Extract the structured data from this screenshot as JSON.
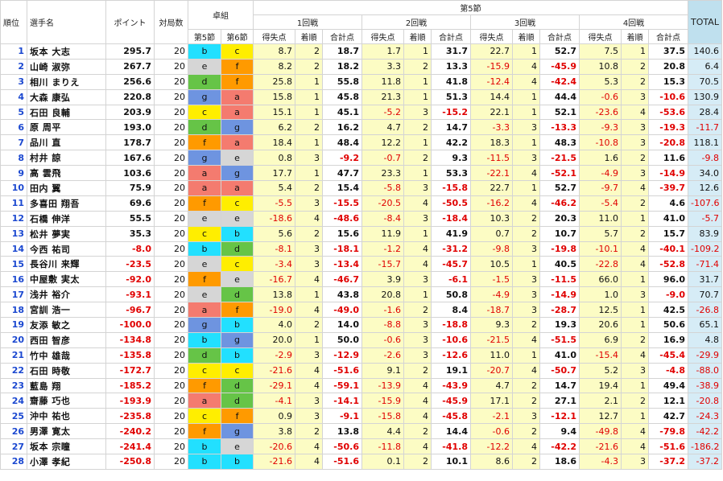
{
  "headers": {
    "rank": "順位",
    "player": "選手名",
    "points": "ポイント",
    "games": "対局数",
    "table_group": "卓組",
    "section5": "第5節",
    "section6": "第6節",
    "stage": "第5節",
    "round1": "1回戦",
    "round2": "2回戦",
    "round3": "3回戦",
    "round4": "4回戦",
    "gain": "得失点",
    "order": "着順",
    "subtotal": "合計点",
    "total": "TOTAL"
  },
  "colors": {
    "a": "#f47b6f",
    "b": "#22e0ff",
    "c": "#ffee00",
    "d": "#66c447",
    "e": "#d6d6d6",
    "f": "#ff9a00",
    "g": "#6e94e0",
    "negative": "#e00000",
    "rank": "#1b48d0"
  },
  "rows": [
    {
      "rank": "1",
      "name": "坂本 大志",
      "points": "295.7",
      "games": "20",
      "t5": "b",
      "t6": "c",
      "r1g": "8.7",
      "r1o": "2",
      "r1s": "18.7",
      "r2g": "1.7",
      "r2o": "1",
      "r2s": "31.7",
      "r3g": "22.7",
      "r3o": "1",
      "r3s": "52.7",
      "r4g": "7.5",
      "r4o": "1",
      "r4s": "37.5",
      "total": "140.6"
    },
    {
      "rank": "2",
      "name": "山崎 淑弥",
      "points": "267.7",
      "games": "20",
      "t5": "e",
      "t6": "f",
      "r1g": "8.2",
      "r1o": "2",
      "r1s": "18.2",
      "r2g": "3.3",
      "r2o": "2",
      "r2s": "13.3",
      "r3g": "-15.9",
      "r3o": "4",
      "r3s": "-45.9",
      "r4g": "10.8",
      "r4o": "2",
      "r4s": "20.8",
      "total": "6.4"
    },
    {
      "rank": "3",
      "name": "相川 まりえ",
      "points": "256.6",
      "games": "20",
      "t5": "d",
      "t6": "f",
      "r1g": "25.8",
      "r1o": "1",
      "r1s": "55.8",
      "r2g": "11.8",
      "r2o": "1",
      "r2s": "41.8",
      "r3g": "-12.4",
      "r3o": "4",
      "r3s": "-42.4",
      "r4g": "5.3",
      "r4o": "2",
      "r4s": "15.3",
      "total": "70.5"
    },
    {
      "rank": "4",
      "name": "大森 康弘",
      "points": "220.8",
      "games": "20",
      "t5": "g",
      "t6": "a",
      "r1g": "15.8",
      "r1o": "1",
      "r1s": "45.8",
      "r2g": "21.3",
      "r2o": "1",
      "r2s": "51.3",
      "r3g": "14.4",
      "r3o": "1",
      "r3s": "44.4",
      "r4g": "-0.6",
      "r4o": "3",
      "r4s": "-10.6",
      "total": "130.9"
    },
    {
      "rank": "5",
      "name": "石田 良輔",
      "points": "203.9",
      "games": "20",
      "t5": "c",
      "t6": "a",
      "r1g": "15.1",
      "r1o": "1",
      "r1s": "45.1",
      "r2g": "-5.2",
      "r2o": "3",
      "r2s": "-15.2",
      "r3g": "22.1",
      "r3o": "1",
      "r3s": "52.1",
      "r4g": "-23.6",
      "r4o": "4",
      "r4s": "-53.6",
      "total": "28.4"
    },
    {
      "rank": "6",
      "name": "原 周平",
      "points": "193.0",
      "games": "20",
      "t5": "d",
      "t6": "g",
      "r1g": "6.2",
      "r1o": "2",
      "r1s": "16.2",
      "r2g": "4.7",
      "r2o": "2",
      "r2s": "14.7",
      "r3g": "-3.3",
      "r3o": "3",
      "r3s": "-13.3",
      "r4g": "-9.3",
      "r4o": "3",
      "r4s": "-19.3",
      "total": "-11.7"
    },
    {
      "rank": "7",
      "name": "品川 直",
      "points": "178.7",
      "games": "20",
      "t5": "f",
      "t6": "a",
      "r1g": "18.4",
      "r1o": "1",
      "r1s": "48.4",
      "r2g": "12.2",
      "r2o": "1",
      "r2s": "42.2",
      "r3g": "18.3",
      "r3o": "1",
      "r3s": "48.3",
      "r4g": "-10.8",
      "r4o": "3",
      "r4s": "-20.8",
      "total": "118.1"
    },
    {
      "rank": "8",
      "name": "村井 諒",
      "points": "167.6",
      "games": "20",
      "t5": "g",
      "t6": "e",
      "r1g": "0.8",
      "r1o": "3",
      "r1s": "-9.2",
      "r2g": "-0.7",
      "r2o": "2",
      "r2s": "9.3",
      "r3g": "-11.5",
      "r3o": "3",
      "r3s": "-21.5",
      "r4g": "1.6",
      "r4o": "2",
      "r4s": "11.6",
      "total": "-9.8"
    },
    {
      "rank": "9",
      "name": "高 雲飛",
      "points": "103.6",
      "games": "20",
      "t5": "a",
      "t6": "g",
      "r1g": "17.7",
      "r1o": "1",
      "r1s": "47.7",
      "r2g": "23.3",
      "r2o": "1",
      "r2s": "53.3",
      "r3g": "-22.1",
      "r3o": "4",
      "r3s": "-52.1",
      "r4g": "-4.9",
      "r4o": "3",
      "r4s": "-14.9",
      "total": "34.0"
    },
    {
      "rank": "10",
      "name": "田内 翼",
      "points": "75.9",
      "games": "20",
      "t5": "a",
      "t6": "a",
      "r1g": "5.4",
      "r1o": "2",
      "r1s": "15.4",
      "r2g": "-5.8",
      "r2o": "3",
      "r2s": "-15.8",
      "r3g": "22.7",
      "r3o": "1",
      "r3s": "52.7",
      "r4g": "-9.7",
      "r4o": "4",
      "r4s": "-39.7",
      "total": "12.6"
    },
    {
      "rank": "11",
      "name": "多喜田 翔吾",
      "points": "69.6",
      "games": "20",
      "t5": "f",
      "t6": "c",
      "r1g": "-5.5",
      "r1o": "3",
      "r1s": "-15.5",
      "r2g": "-20.5",
      "r2o": "4",
      "r2s": "-50.5",
      "r3g": "-16.2",
      "r3o": "4",
      "r3s": "-46.2",
      "r4g": "-5.4",
      "r4o": "2",
      "r4s": "4.6",
      "total": "-107.6"
    },
    {
      "rank": "12",
      "name": "石橋 伸洋",
      "points": "55.5",
      "games": "20",
      "t5": "e",
      "t6": "e",
      "r1g": "-18.6",
      "r1o": "4",
      "r1s": "-48.6",
      "r2g": "-8.4",
      "r2o": "3",
      "r2s": "-18.4",
      "r3g": "10.3",
      "r3o": "2",
      "r3s": "20.3",
      "r4g": "11.0",
      "r4o": "1",
      "r4s": "41.0",
      "total": "-5.7"
    },
    {
      "rank": "13",
      "name": "松井 夢実",
      "points": "35.3",
      "games": "20",
      "t5": "c",
      "t6": "b",
      "r1g": "5.6",
      "r1o": "2",
      "r1s": "15.6",
      "r2g": "11.9",
      "r2o": "1",
      "r2s": "41.9",
      "r3g": "0.7",
      "r3o": "2",
      "r3s": "10.7",
      "r4g": "5.7",
      "r4o": "2",
      "r4s": "15.7",
      "total": "83.9"
    },
    {
      "rank": "14",
      "name": "今西 祐司",
      "points": "-8.0",
      "games": "20",
      "t5": "b",
      "t6": "d",
      "r1g": "-8.1",
      "r1o": "3",
      "r1s": "-18.1",
      "r2g": "-1.2",
      "r2o": "4",
      "r2s": "-31.2",
      "r3g": "-9.8",
      "r3o": "3",
      "r3s": "-19.8",
      "r4g": "-10.1",
      "r4o": "4",
      "r4s": "-40.1",
      "total": "-109.2"
    },
    {
      "rank": "15",
      "name": "長谷川 来輝",
      "points": "-23.5",
      "games": "20",
      "t5": "e",
      "t6": "c",
      "r1g": "-3.4",
      "r1o": "3",
      "r1s": "-13.4",
      "r2g": "-15.7",
      "r2o": "4",
      "r2s": "-45.7",
      "r3g": "10.5",
      "r3o": "1",
      "r3s": "40.5",
      "r4g": "-22.8",
      "r4o": "4",
      "r4s": "-52.8",
      "total": "-71.4"
    },
    {
      "rank": "16",
      "name": "中屋敷 実太",
      "points": "-92.0",
      "games": "20",
      "t5": "f",
      "t6": "e",
      "r1g": "-16.7",
      "r1o": "4",
      "r1s": "-46.7",
      "r2g": "3.9",
      "r2o": "3",
      "r2s": "-6.1",
      "r3g": "-1.5",
      "r3o": "3",
      "r3s": "-11.5",
      "r4g": "66.0",
      "r4o": "1",
      "r4s": "96.0",
      "total": "31.7"
    },
    {
      "rank": "17",
      "name": "浅井 裕介",
      "points": "-93.1",
      "games": "20",
      "t5": "e",
      "t6": "d",
      "r1g": "13.8",
      "r1o": "1",
      "r1s": "43.8",
      "r2g": "20.8",
      "r2o": "1",
      "r2s": "50.8",
      "r3g": "-4.9",
      "r3o": "3",
      "r3s": "-14.9",
      "r4g": "1.0",
      "r4o": "3",
      "r4s": "-9.0",
      "total": "70.7"
    },
    {
      "rank": "18",
      "name": "宮訓 浩一",
      "points": "-96.7",
      "games": "20",
      "t5": "a",
      "t6": "f",
      "r1g": "-19.0",
      "r1o": "4",
      "r1s": "-49.0",
      "r2g": "-1.6",
      "r2o": "2",
      "r2s": "8.4",
      "r3g": "-18.7",
      "r3o": "3",
      "r3s": "-28.7",
      "r4g": "12.5",
      "r4o": "1",
      "r4s": "42.5",
      "total": "-26.8"
    },
    {
      "rank": "19",
      "name": "友添 敏之",
      "points": "-100.0",
      "games": "20",
      "t5": "g",
      "t6": "b",
      "r1g": "4.0",
      "r1o": "2",
      "r1s": "14.0",
      "r2g": "-8.8",
      "r2o": "3",
      "r2s": "-18.8",
      "r3g": "9.3",
      "r3o": "2",
      "r3s": "19.3",
      "r4g": "20.6",
      "r4o": "1",
      "r4s": "50.6",
      "total": "65.1"
    },
    {
      "rank": "20",
      "name": "西田 智彦",
      "points": "-134.8",
      "games": "20",
      "t5": "b",
      "t6": "g",
      "r1g": "20.0",
      "r1o": "1",
      "r1s": "50.0",
      "r2g": "-0.6",
      "r2o": "3",
      "r2s": "-10.6",
      "r3g": "-21.5",
      "r3o": "4",
      "r3s": "-51.5",
      "r4g": "6.9",
      "r4o": "2",
      "r4s": "16.9",
      "total": "4.8"
    },
    {
      "rank": "21",
      "name": "竹中 雄哉",
      "points": "-135.8",
      "games": "20",
      "t5": "d",
      "t6": "b",
      "r1g": "-2.9",
      "r1o": "3",
      "r1s": "-12.9",
      "r2g": "-2.6",
      "r2o": "3",
      "r2s": "-12.6",
      "r3g": "11.0",
      "r3o": "1",
      "r3s": "41.0",
      "r4g": "-15.4",
      "r4o": "4",
      "r4s": "-45.4",
      "total": "-29.9"
    },
    {
      "rank": "22",
      "name": "石田 時敬",
      "points": "-172.7",
      "games": "20",
      "t5": "c",
      "t6": "c",
      "r1g": "-21.6",
      "r1o": "4",
      "r1s": "-51.6",
      "r2g": "9.1",
      "r2o": "2",
      "r2s": "19.1",
      "r3g": "-20.7",
      "r3o": "4",
      "r3s": "-50.7",
      "r4g": "5.2",
      "r4o": "3",
      "r4s": "-4.8",
      "total": "-88.0"
    },
    {
      "rank": "23",
      "name": "藍島 翔",
      "points": "-185.2",
      "games": "20",
      "t5": "f",
      "t6": "d",
      "r1g": "-29.1",
      "r1o": "4",
      "r1s": "-59.1",
      "r2g": "-13.9",
      "r2o": "4",
      "r2s": "-43.9",
      "r3g": "4.7",
      "r3o": "2",
      "r3s": "14.7",
      "r4g": "19.4",
      "r4o": "1",
      "r4s": "49.4",
      "total": "-38.9"
    },
    {
      "rank": "24",
      "name": "齋藤 巧也",
      "points": "-193.9",
      "games": "20",
      "t5": "a",
      "t6": "d",
      "r1g": "-4.1",
      "r1o": "3",
      "r1s": "-14.1",
      "r2g": "-15.9",
      "r2o": "4",
      "r2s": "-45.9",
      "r3g": "17.1",
      "r3o": "2",
      "r3s": "27.1",
      "r4g": "2.1",
      "r4o": "2",
      "r4s": "12.1",
      "total": "-20.8"
    },
    {
      "rank": "25",
      "name": "沖中 祐也",
      "points": "-235.8",
      "games": "20",
      "t5": "c",
      "t6": "f",
      "r1g": "0.9",
      "r1o": "3",
      "r1s": "-9.1",
      "r2g": "-15.8",
      "r2o": "4",
      "r2s": "-45.8",
      "r3g": "-2.1",
      "r3o": "3",
      "r3s": "-12.1",
      "r4g": "12.7",
      "r4o": "1",
      "r4s": "42.7",
      "total": "-24.3"
    },
    {
      "rank": "26",
      "name": "男澤 寛太",
      "points": "-240.2",
      "games": "20",
      "t5": "f",
      "t6": "g",
      "r1g": "3.8",
      "r1o": "2",
      "r1s": "13.8",
      "r2g": "4.4",
      "r2o": "2",
      "r2s": "14.4",
      "r3g": "-0.6",
      "r3o": "2",
      "r3s": "9.4",
      "r4g": "-49.8",
      "r4o": "4",
      "r4s": "-79.8",
      "total": "-42.2"
    },
    {
      "rank": "27",
      "name": "坂本 宗瞳",
      "points": "-241.4",
      "games": "20",
      "t5": "b",
      "t6": "e",
      "r1g": "-20.6",
      "r1o": "4",
      "r1s": "-50.6",
      "r2g": "-11.8",
      "r2o": "4",
      "r2s": "-41.8",
      "r3g": "-12.2",
      "r3o": "4",
      "r3s": "-42.2",
      "r4g": "-21.6",
      "r4o": "4",
      "r4s": "-51.6",
      "total": "-186.2"
    },
    {
      "rank": "28",
      "name": "小澤 孝紀",
      "points": "-250.8",
      "games": "20",
      "t5": "b",
      "t6": "b",
      "r1g": "-21.6",
      "r1o": "4",
      "r1s": "-51.6",
      "r2g": "0.1",
      "r2o": "2",
      "r2s": "10.1",
      "r3g": "8.6",
      "r3o": "2",
      "r3s": "18.6",
      "r4g": "-4.3",
      "r4o": "3",
      "r4s": "-37.2",
      "total": "-37.2"
    }
  ]
}
